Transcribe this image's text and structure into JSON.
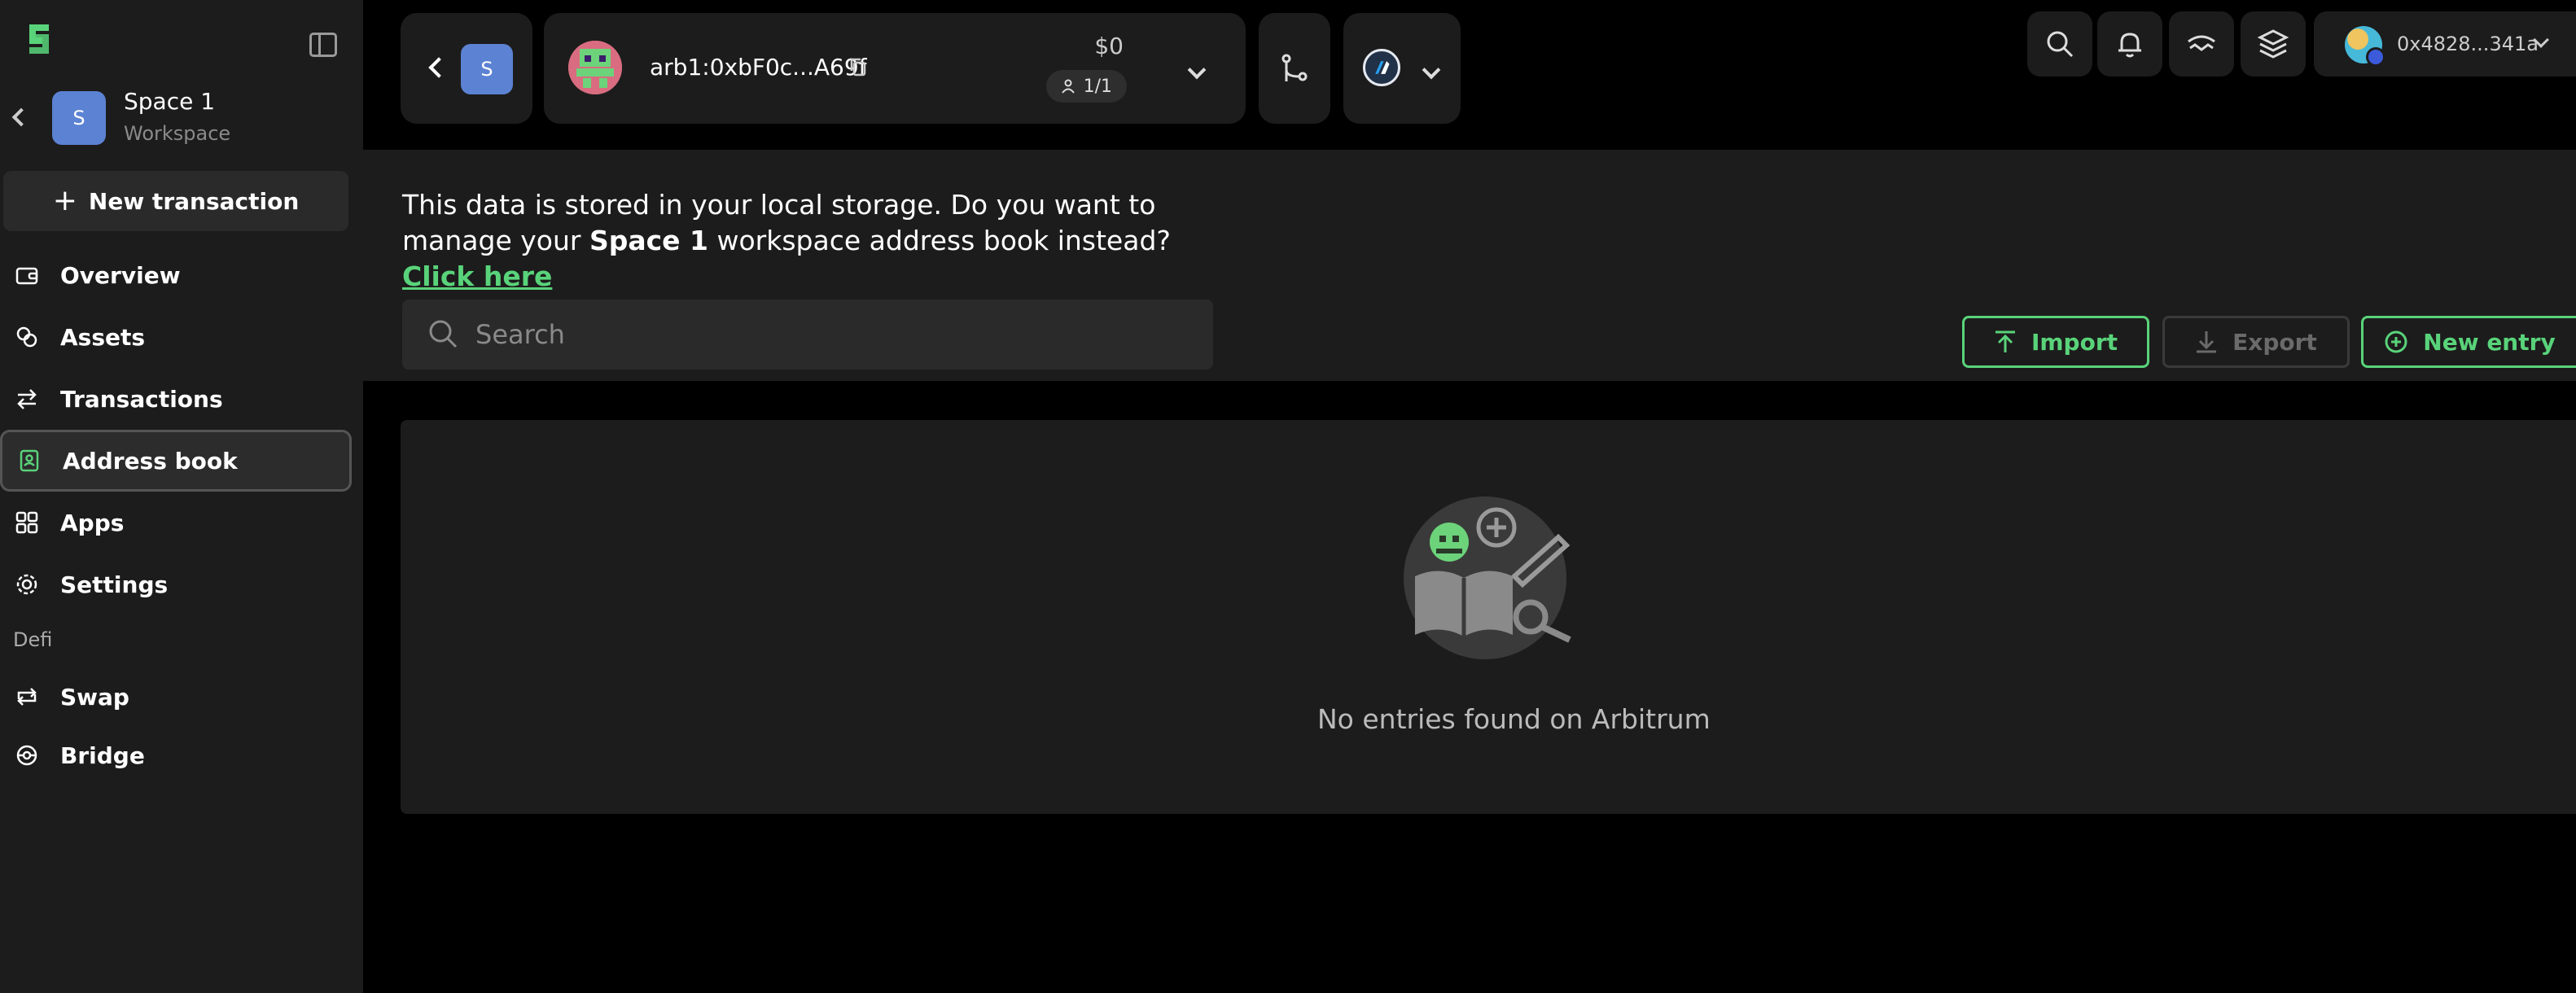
{
  "sidebar": {
    "space": {
      "avatar_letter": "S",
      "name": "Space 1",
      "subtitle": "Workspace"
    },
    "new_transaction_label": "New transaction",
    "nav": [
      {
        "label": "Overview",
        "icon": "wallet-icon"
      },
      {
        "label": "Assets",
        "icon": "coins-icon"
      },
      {
        "label": "Transactions",
        "icon": "transfer-arrows-icon"
      },
      {
        "label": "Address book",
        "icon": "address-book-icon",
        "active": true
      },
      {
        "label": "Apps",
        "icon": "apps-grid-icon"
      },
      {
        "label": "Settings",
        "icon": "gear-icon"
      }
    ],
    "section_label": "Defi",
    "defi_nav": [
      {
        "label": "Swap",
        "icon": "swap-icon"
      },
      {
        "label": "Bridge",
        "icon": "bridge-icon"
      }
    ]
  },
  "topbar": {
    "space_avatar_letter": "S",
    "safe_address": "arb1:0xbF0c...A69f",
    "balance": "$0",
    "owners": "1/1",
    "wallet_address": "0x4828...341a"
  },
  "main": {
    "notice_part1": "This data is stored in your local storage. Do you want to manage your ",
    "notice_space": "Space 1",
    "notice_part2": " workspace address book instead? ",
    "notice_link": "Click here",
    "search_placeholder": "Search",
    "import_label": "Import",
    "export_label": "Export",
    "new_entry_label": "New entry",
    "empty_message": "No entries found on Arbitrum"
  },
  "colors": {
    "accent": "#59d37a",
    "surface": "#1c1c1c",
    "background": "#000000",
    "space_avatar": "#5c82d3"
  }
}
